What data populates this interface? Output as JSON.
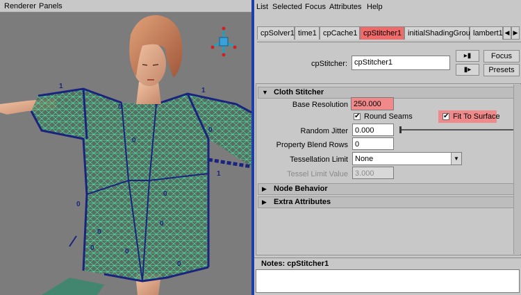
{
  "viewport": {
    "menus": [
      "Renderer",
      "Panels"
    ]
  },
  "attribute_editor": {
    "menus": [
      "List",
      "Selected",
      "Focus",
      "Attributes",
      "Help"
    ],
    "tabs": [
      "cpSolver1",
      "time1",
      "cpCache1",
      "cpStitcher1",
      "initialShadingGroup",
      "lambert1"
    ],
    "active_tab": "cpStitcher1",
    "node_label": "cpStitcher:",
    "node_name": "cpStitcher1",
    "focus_button": "Focus",
    "presets_button": "Presets",
    "sections": {
      "cloth_stitcher": {
        "title": "Cloth Stitcher",
        "expanded": true,
        "base_resolution_label": "Base Resolution",
        "base_resolution": "250.000",
        "round_seams_label": "Round Seams",
        "round_seams": true,
        "fit_to_surface_label": "Fit To Surface",
        "fit_to_surface": true,
        "random_jitter_label": "Random Jitter",
        "random_jitter": "0.000",
        "property_blend_rows_label": "Property Blend Rows",
        "property_blend_rows": "0",
        "tessellation_limit_label": "Tessellation Limit",
        "tessellation_limit": "None",
        "tessel_limit_value_label": "Tessel Limit Value",
        "tessel_limit_value": "3.000"
      },
      "node_behavior": {
        "title": "Node Behavior",
        "expanded": false
      },
      "extra_attributes": {
        "title": "Extra Attributes",
        "expanded": false
      }
    },
    "notes_label": "Notes: cpStitcher1",
    "notes_text": ""
  },
  "colors": {
    "highlight": "#f06a6a",
    "mesh": "#48f0a8",
    "cage": "#1a237e",
    "viewport_bg": "#7c7c7c"
  }
}
